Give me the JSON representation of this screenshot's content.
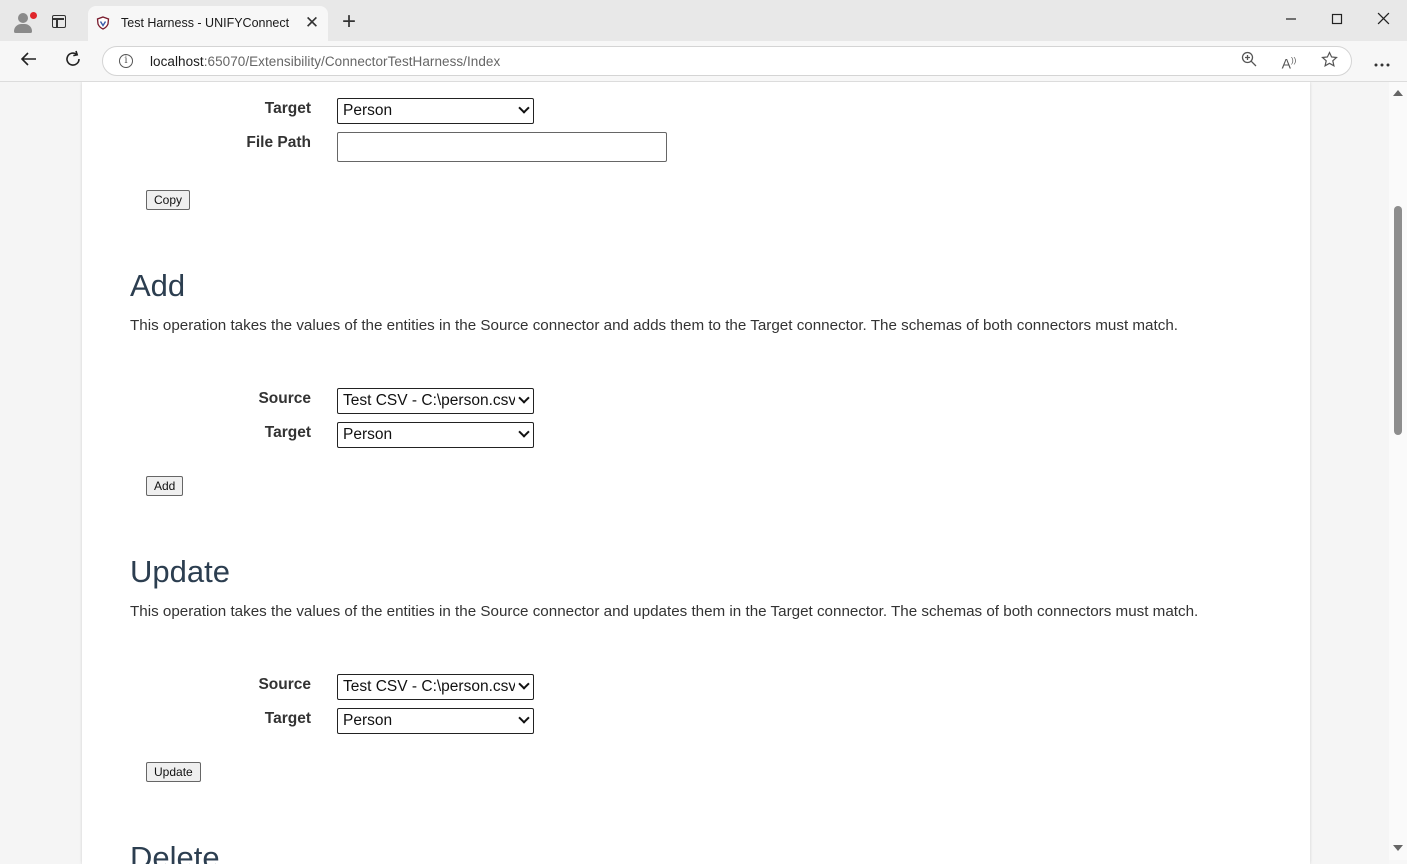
{
  "browser": {
    "tab_title": "Test Harness - UNIFYConnect",
    "tab_close": "✕",
    "new_tab": "+",
    "url_host": "localhost",
    "url_rest": ":65070/Extensibility/ConnectorTestHarness/Index",
    "icons": [
      "profile-icon",
      "tab-actions-icon",
      "back-icon",
      "refresh-icon",
      "info-icon",
      "zoom-icon",
      "read-aloud-icon",
      "favorite-icon",
      "more-icon",
      "minimize-icon",
      "maximize-icon",
      "close-icon"
    ]
  },
  "copy_section": {
    "target_label": "Target",
    "target_value": "Person",
    "filepath_label": "File Path",
    "filepath_value": "",
    "button": "Copy"
  },
  "add_section": {
    "heading": "Add",
    "description": "This operation takes the values of the entities in the Source connector and adds them to the Target connector. The schemas of both connectors must match.",
    "source_label": "Source",
    "source_value": "Test CSV - C:\\person.csv",
    "target_label": "Target",
    "target_value": "Person",
    "button": "Add"
  },
  "update_section": {
    "heading": "Update",
    "description": "This operation takes the values of the entities in the Source connector and updates them in the Target connector. The schemas of both connectors must match.",
    "source_label": "Source",
    "source_value": "Test CSV - C:\\person.csv",
    "target_label": "Target",
    "target_value": "Person",
    "button": "Update"
  },
  "delete_section": {
    "heading": "Delete"
  }
}
